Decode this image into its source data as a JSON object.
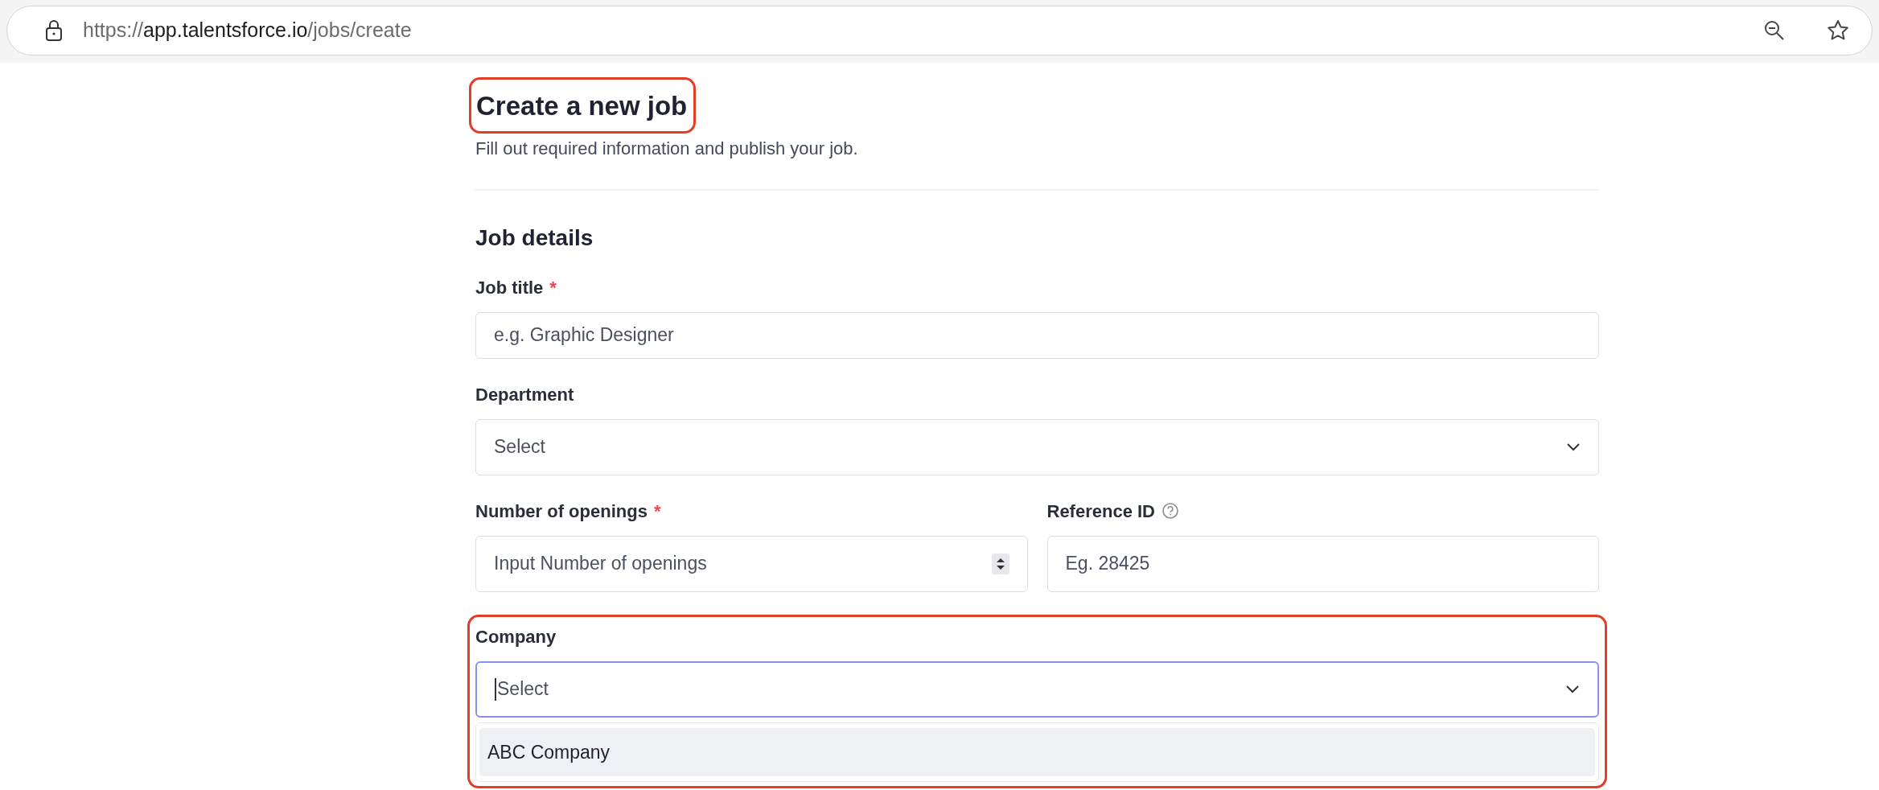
{
  "browser": {
    "url_scheme": "https://",
    "url_host": "app.talentsforce.io",
    "url_path": "/jobs/create"
  },
  "page": {
    "title": "Create a new job",
    "title_highlighted": true,
    "subtitle": "Fill out required information and publish your job."
  },
  "section": {
    "title": "Job details"
  },
  "rows": [
    {
      "fields": [
        {
          "kind": "text",
          "label": "Job title",
          "required_mark": "*",
          "placeholder": "e.g. Graphic Designer"
        }
      ]
    },
    {
      "fields": [
        {
          "kind": "select",
          "label": "Department",
          "placeholder": "Select"
        }
      ]
    },
    {
      "fields": [
        {
          "kind": "number",
          "label": "Number of openings",
          "required_mark": "*",
          "placeholder": "Input Number of openings"
        },
        {
          "kind": "text",
          "label": "Reference ID",
          "help": true,
          "placeholder": "Eg. 28425"
        }
      ]
    },
    {
      "highlighted": true,
      "fields": [
        {
          "kind": "select",
          "label": "Company",
          "focused": true,
          "placeholder": "Select",
          "options": [
            {
              "label": "ABC Company",
              "highlighted": true
            }
          ]
        }
      ]
    }
  ]
}
